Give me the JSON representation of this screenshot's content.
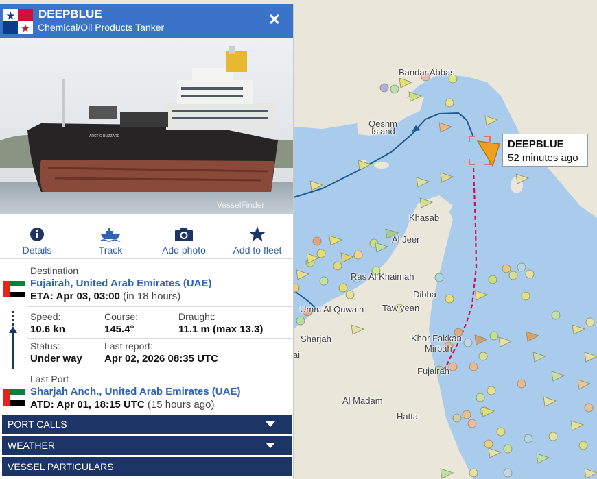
{
  "vessel": {
    "name": "DEEPBLUE",
    "type": "Chemical/Oil Products Tanker",
    "hull_text": "ARCTIC BLIZZARD",
    "photo_credit": "VesselFinder"
  },
  "actions": {
    "details": "Details",
    "track": "Track",
    "add_photo": "Add photo",
    "add_to_fleet": "Add to fleet"
  },
  "voyage": {
    "destination_label": "Destination",
    "destination": "Fujairah, United Arab Emirates (UAE)",
    "eta_prefix": "ETA: Apr 03, 03:00",
    "eta_relative": "(in 18 hours)",
    "speed_label": "Speed:",
    "speed": "10.6 kn",
    "course_label": "Course:",
    "course": "145.4°",
    "draught_label": "Draught:",
    "draught": "11.1 m (max 13.3)",
    "status_label": "Status:",
    "status": "Under way",
    "last_report_label": "Last report:",
    "last_report": "Apr 02, 2026 08:35 UTC",
    "last_port_label": "Last Port",
    "last_port": "Sharjah Anch., United Arab Emirates (UAE)",
    "atd_prefix": "ATD: Apr 01, 18:15 UTC",
    "atd_relative": "(15 hours ago)"
  },
  "sections": {
    "port_calls": "PORT CALLS",
    "weather": "WEATHER",
    "vessel_particulars": "VESSEL PARTICULARS"
  },
  "map": {
    "tooltip_name": "DEEPBLUE",
    "tooltip_time": "52 minutes ago",
    "labels": {
      "bandar_abbas": "Bandar Abbas",
      "qeshm": "Qeshm",
      "island": "Island",
      "khasab": "Khasab",
      "al_jeer": "Al Jeer",
      "ras_al_khaimah": "Ras Al Khaimah",
      "dibba": "Dibba",
      "umm_al_quwain": "Umm Al Quwain",
      "tawiyean": "Tawiyean",
      "sharjah": "Sharjah",
      "dubai": "Dubai",
      "khor_fakkan": "Khor Fakkan",
      "mirbah": "Mirbah",
      "fujairah": "Fujairah",
      "al_madam": "Al Madam",
      "hatta": "Hatta"
    }
  },
  "colors": {
    "header_blue": "#3a73c8",
    "nav_dark": "#1d3566",
    "link_blue": "#2e63b5",
    "sea": "#aaccec",
    "land": "#ebe6da",
    "track_line": "#1d5a8e",
    "predicted_route": "#cc1155",
    "vessel_marker": "#f0a020"
  }
}
